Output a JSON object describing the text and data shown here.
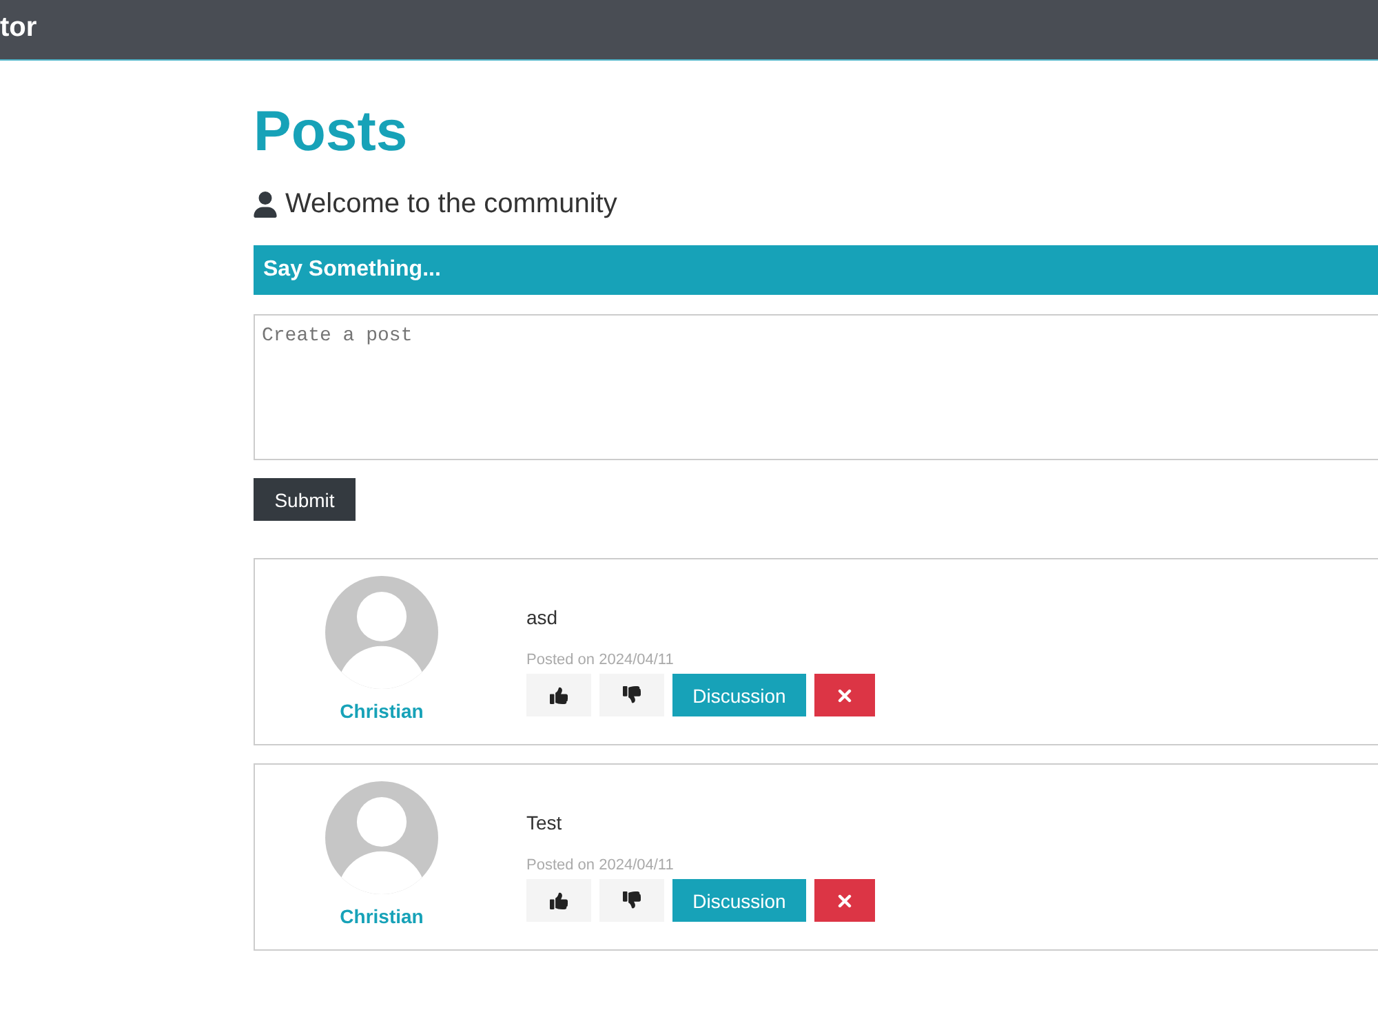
{
  "navbar": {
    "brand": "tor"
  },
  "page": {
    "title": "Posts",
    "lead": "Welcome to the community"
  },
  "post_form": {
    "header": "Say Something...",
    "placeholder": "Create a post",
    "submit": "Submit"
  },
  "posts": [
    {
      "author": "Christian",
      "text": "asd",
      "date": "Posted on 2024/04/11",
      "discussion": "Discussion"
    },
    {
      "author": "Christian",
      "text": "Test",
      "date": "Posted on 2024/04/11",
      "discussion": "Discussion"
    }
  ]
}
